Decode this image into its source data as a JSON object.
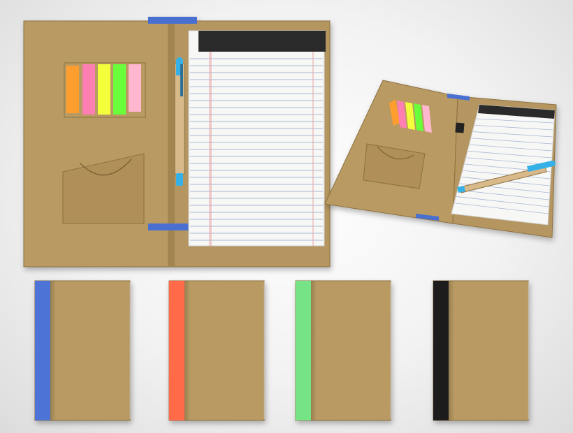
{
  "scene": {
    "description_free": true
  },
  "colors": {
    "kraft": "#b89a62",
    "kraft_dark": "#a3864f",
    "kraft_edge": "#8c713f",
    "paper": "#f7f7f5",
    "rule": "#a9b8d6",
    "margin": "#e7a3a3",
    "pad_top": "#2b2b2b",
    "hinge_blue": "#4a6fd1",
    "pen_blue": "#35b1e8",
    "sticky": [
      "#ff9d2e",
      "#ff7fb3",
      "#f4ff3a",
      "#6bff3a",
      "#ffb6cf"
    ]
  },
  "notebooks": [
    {
      "spine_color": "#4d73d6"
    },
    {
      "spine_color": "#ff6a4a"
    },
    {
      "spine_color": "#76e486"
    },
    {
      "spine_color": "#1e1e1e"
    }
  ]
}
